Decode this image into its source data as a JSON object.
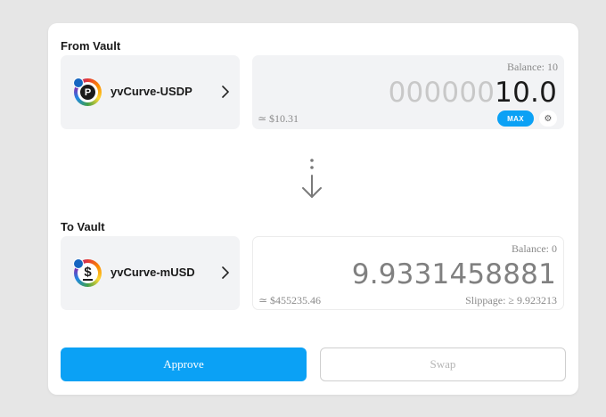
{
  "from": {
    "section_label": "From Vault",
    "vault_name": "yvCurve-USDP",
    "token_glyph": "P",
    "icon": "usdp-token-icon",
    "balance": "Balance: 10",
    "amount_padding": "000000",
    "amount_value": "10.0",
    "usd_value": "≃ $10.31",
    "max_label": "MAX",
    "settings_icon": "gear-icon"
  },
  "transition_icon": "arrow-down-icon",
  "to": {
    "section_label": "To Vault",
    "vault_name": "yvCurve-mUSD",
    "token_glyph": "$",
    "icon": "musd-token-icon",
    "balance": "Balance: 0",
    "amount_value": "9.9331458881",
    "usd_value": "≃ $455235.46",
    "slippage": "Slippage: ≥ 9.923213"
  },
  "actions": {
    "approve_label": "Approve",
    "swap_label": "Swap"
  },
  "colors": {
    "accent": "#0ba1f5",
    "panel": "#f2f3f5",
    "background": "#e6e6e6"
  }
}
